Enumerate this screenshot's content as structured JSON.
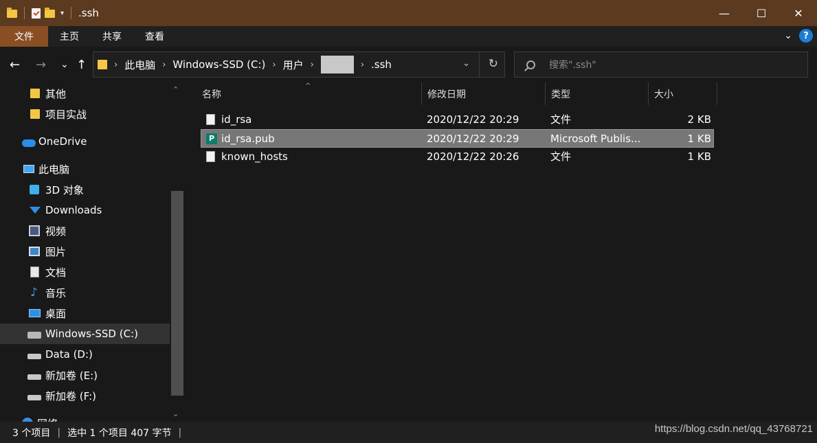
{
  "window": {
    "title": ".ssh",
    "minimize": "—",
    "maximize": "☐",
    "close": "✕"
  },
  "ribbon": {
    "tabs": [
      "文件",
      "主页",
      "共享",
      "查看"
    ]
  },
  "nav": {
    "back": "←",
    "forward": "→",
    "recent": "⌄",
    "up": "↑"
  },
  "address": {
    "crumbs": [
      "此电脑",
      "Windows-SSD (C:)",
      "用户",
      ".ssh"
    ],
    "separator": "›"
  },
  "search": {
    "placeholder": "搜索\".ssh\""
  },
  "sidebar": {
    "items": [
      {
        "label": "其他",
        "icon": "folder-icon"
      },
      {
        "label": "项目实战",
        "icon": "folder-icon"
      },
      {
        "label": "OneDrive",
        "icon": "onedrive-cloud-icon"
      },
      {
        "label": "此电脑",
        "icon": "this-pc-icon"
      },
      {
        "label": "3D 对象",
        "icon": "3d-objects-icon"
      },
      {
        "label": "Downloads",
        "icon": "downloads-arrow-icon"
      },
      {
        "label": "视频",
        "icon": "videos-icon"
      },
      {
        "label": "图片",
        "icon": "pictures-icon"
      },
      {
        "label": "文档",
        "icon": "documents-icon"
      },
      {
        "label": "音乐",
        "icon": "music-note-icon"
      },
      {
        "label": "桌面",
        "icon": "desktop-icon"
      },
      {
        "label": "Windows-SSD (C:)",
        "icon": "windows-drive-icon"
      },
      {
        "label": "Data (D:)",
        "icon": "drive-icon"
      },
      {
        "label": "新加卷 (E:)",
        "icon": "drive-icon"
      },
      {
        "label": "新加卷 (F:)",
        "icon": "drive-icon"
      },
      {
        "label": "网络",
        "icon": "network-icon"
      }
    ]
  },
  "filelist": {
    "columns": [
      "名称",
      "修改日期",
      "类型",
      "大小"
    ],
    "rows": [
      {
        "name": "id_rsa",
        "date": "2020/12/22 20:29",
        "type": "文件",
        "size": "2 KB"
      },
      {
        "name": "id_rsa.pub",
        "date": "2020/12/22 20:29",
        "type": "Microsoft Publis...",
        "size": "1 KB"
      },
      {
        "name": "known_hosts",
        "date": "2020/12/22 20:26",
        "type": "文件",
        "size": "1 KB"
      }
    ]
  },
  "status": {
    "count": "3 个项目",
    "selection": "选中 1 个项目  407 字节",
    "separator": "|",
    "watermark": "https://blog.csdn.net/qq_43768721"
  }
}
